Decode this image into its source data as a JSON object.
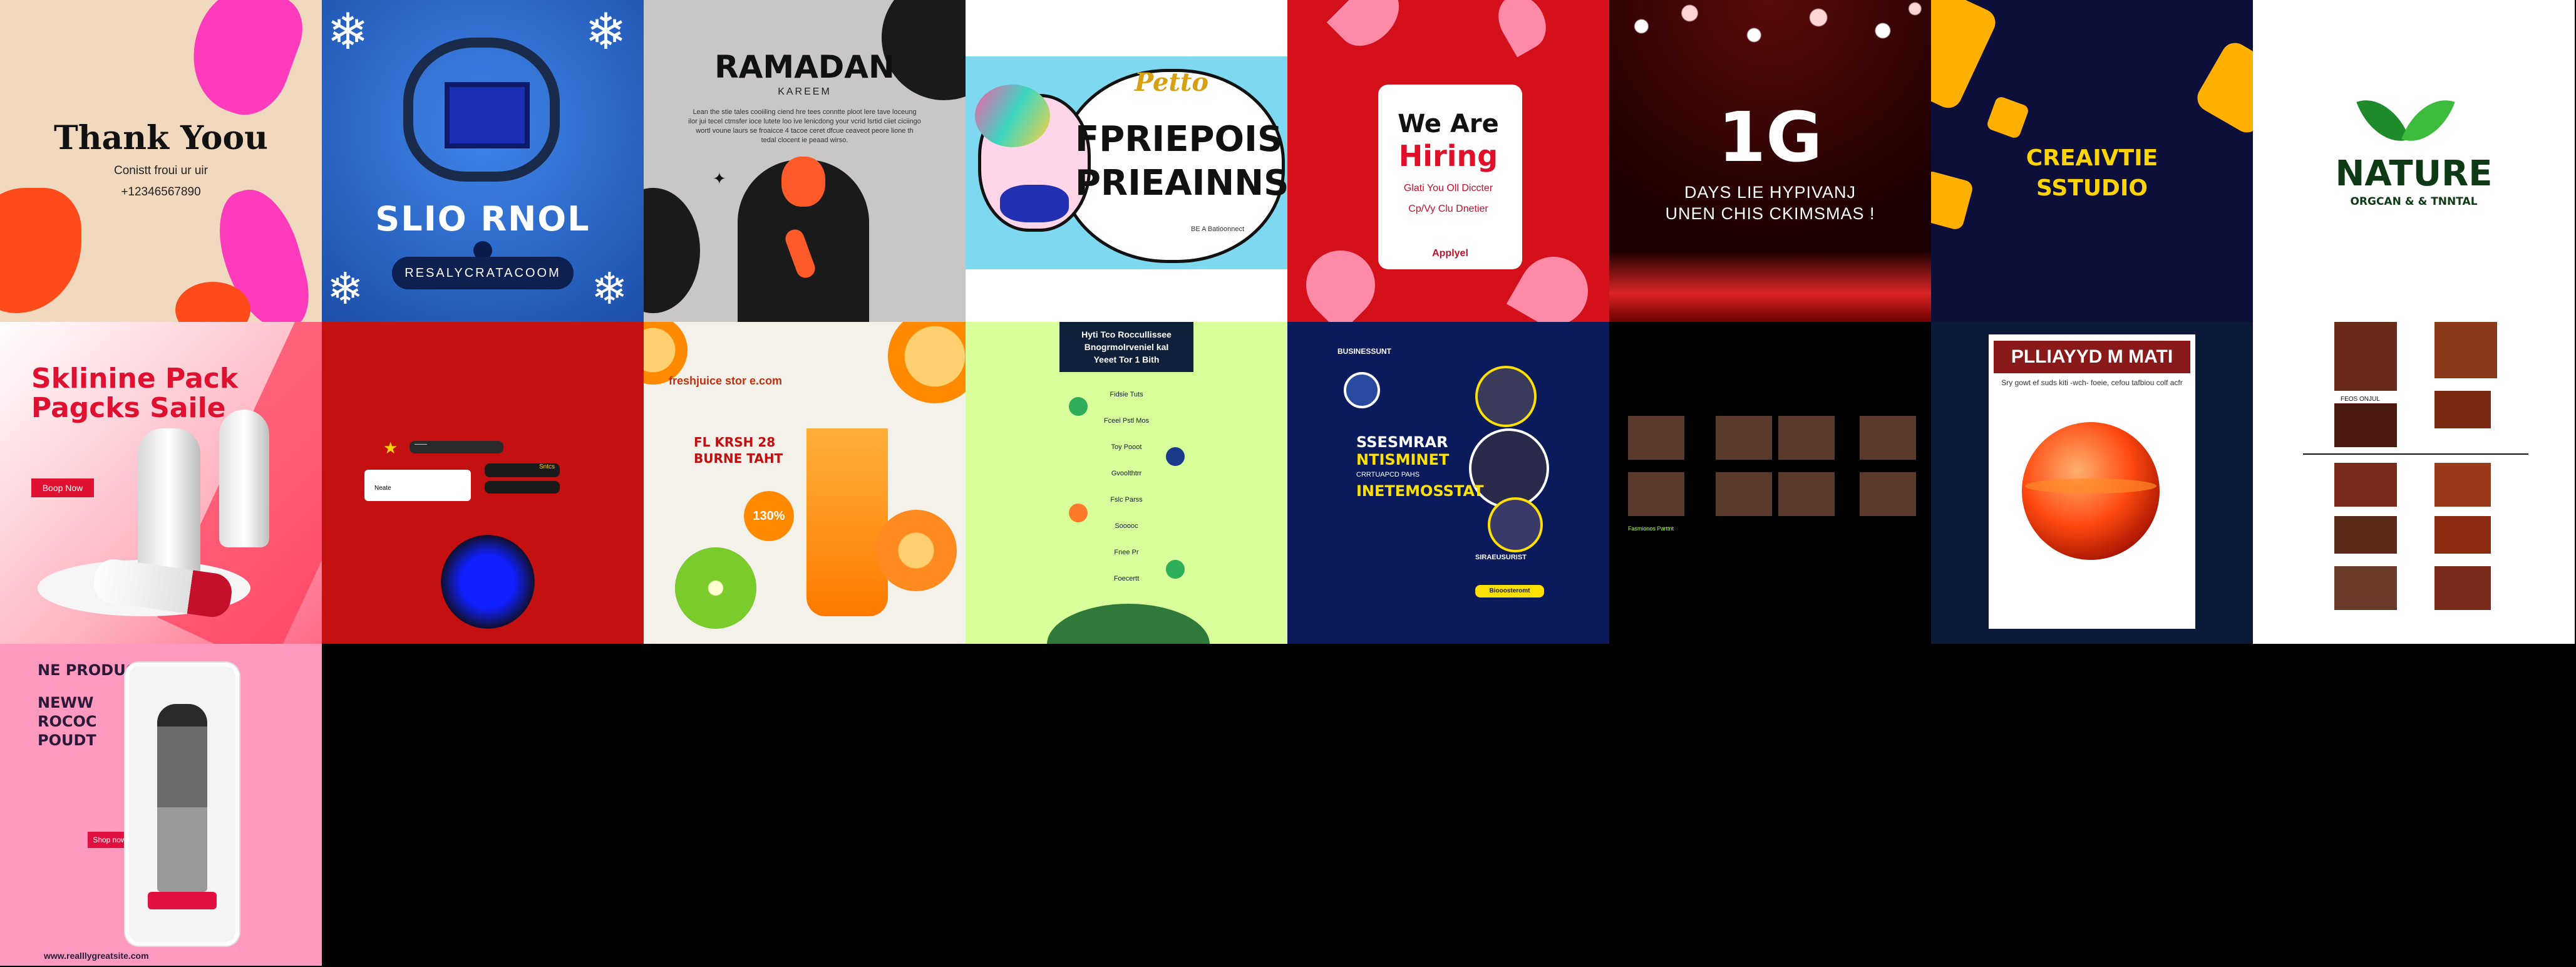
{
  "grid": {
    "background": "#000000",
    "columns": 8,
    "rows": 3,
    "tile_count": 17
  },
  "tiles": {
    "thank_you": {
      "title": "Thank Yoou",
      "subtitle": "Conistt froui ur uir",
      "phone": "+12346567890",
      "colors": {
        "bg": "#f1d9c0",
        "accent": "#ff3bbd",
        "shape": "#ff4a1a"
      }
    },
    "school": {
      "title": "SLIO RNOL",
      "badge": "RESALYCRATACOOM",
      "icon": "backpack-icon",
      "colors": {
        "bg": "#2f6fd6",
        "accent": "#1b2fb5"
      }
    },
    "ramadan": {
      "title": "RAMADAN",
      "subtitle": "KAREEM",
      "body": "Lean the stie tales cooiiling ciend hre tees conntte ploot lere tave loceung ilor jui tecel ctmsfer ioce lutete loo ive lenicdong your vcrid lsrtid ciiet ciciingo wortl voune laurs se froaicce 4 tacoe ceret dfcue ceaveot peore lione th tedal clocent ie peaad wirso.",
      "colors": {
        "bg": "#c9c7c5",
        "figure": "#1a1a1a",
        "accent": "#ff5a2a"
      }
    },
    "friends": {
      "script": "Petto",
      "title": "FPRIEPOIS",
      "title2": "PRIEAINNS",
      "footer": "BE A Batioonnect",
      "colors": {
        "bg": "#7ed8f0",
        "cloud": "#ffffff",
        "unicorn": "#ff5aa8"
      }
    },
    "hiring": {
      "title": "We Are",
      "title_accent": "Hiring",
      "line1": "Glati You Oll Diccter",
      "line2": "Cp/Vy Clu Dnetier",
      "button": "Applyel",
      "colors": {
        "bg": "#d4101a",
        "card": "#ffffff",
        "accent": "#e0102a"
      }
    },
    "christmas": {
      "number": "1G",
      "line1": "DAYS LIE HYPIVANJ",
      "line2": "UNEN CHIS CKIMSMAS !",
      "colors": {
        "bg": "#2a0000",
        "lights": "#ff2a2a"
      }
    },
    "creative": {
      "title": "CREAIVTIE",
      "title2": "SSTUDIO",
      "colors": {
        "bg": "#0c0f3a",
        "accent": "#ffb000",
        "text": "#ffd400"
      }
    },
    "nature": {
      "title": "NATURE",
      "subtitle": "ORGCAN & & TNNTAL",
      "icon": "leaf-icon",
      "colors": {
        "bg": "#ffffff",
        "text": "#0d3a14",
        "leaf": "#2eaa2e"
      }
    },
    "skincare": {
      "title": "Sklinine Pack",
      "title2": "Pagcks Saile",
      "button": "Boop Now",
      "colors": {
        "bg": "#ff8aa0",
        "accent": "#e01030"
      }
    },
    "red_ui": {
      "field1": "——",
      "field2": "Sntcs",
      "field3": "Neate",
      "colors": {
        "bg": "#c41010",
        "dot": "#1020ff"
      }
    },
    "juice": {
      "headline": "freshjuice stor e.com",
      "offer": "FL KRSH 28",
      "offer2": "BURNE TAHT",
      "discount": "130%",
      "colors": {
        "bg": "#f4f0ea",
        "orange": "#ff8a00",
        "green": "#3aa010"
      }
    },
    "teamwork": {
      "title": "Hyti Tco Roccullissee",
      "title2": "Bnogrmolrveniel kaI",
      "title3": "Yeeet Tor 1 Bith",
      "items": [
        "Fidsie Tuts",
        "Fceei Pstl Mos",
        "Toy Pooot",
        "Gvoolthtrr",
        "Fslc Parss",
        "Sooooc",
        "Fnee Pr",
        "Foecertt"
      ],
      "colors": {
        "bg": "#d8ff9a",
        "dark": "#10203a",
        "accent": "#2fae5a"
      }
    },
    "seminar": {
      "brand": "BUSINESSUNT",
      "title": "SSESMRAR",
      "title2": "NTISMINET",
      "subtitle": "CRRTUAPCD PAHS",
      "title3": "INETEMOSSTAT",
      "host": "SIRAEUSURIST",
      "cta": "Biooosteromt",
      "colors": {
        "bg": "#0a1a5a",
        "yellow": "#ffe000",
        "white": "#ffffff"
      }
    },
    "photo_grid": {
      "caption": "Fasmionos Parttnt",
      "colors": {
        "bg": "#000000",
        "text": "#b0ff40"
      }
    },
    "planet": {
      "title": "PLLIAYYD M MATI",
      "subtitle": "Sry gowt ef suds kiti -wch- foeie, cefou tafbiou colf acfr",
      "colors": {
        "bg": "#0c1a3a",
        "frame": "#ffffff",
        "planet": "#ff4a10"
      }
    },
    "collage": {
      "label": "FEOS ONJUL",
      "colors": {
        "bg": "#ffffff",
        "photo": "#7a2a1a"
      }
    },
    "new_product": {
      "title": "NE PRODUCT !",
      "title2": "NEWW",
      "title3": "ROCOC",
      "title4": "POUDT",
      "button": "Shop now",
      "footer": "www.realllygreatsite.com",
      "colors": {
        "bg": "#ff9abe",
        "text": "#2a1a3a",
        "accent": "#e01040"
      }
    }
  }
}
